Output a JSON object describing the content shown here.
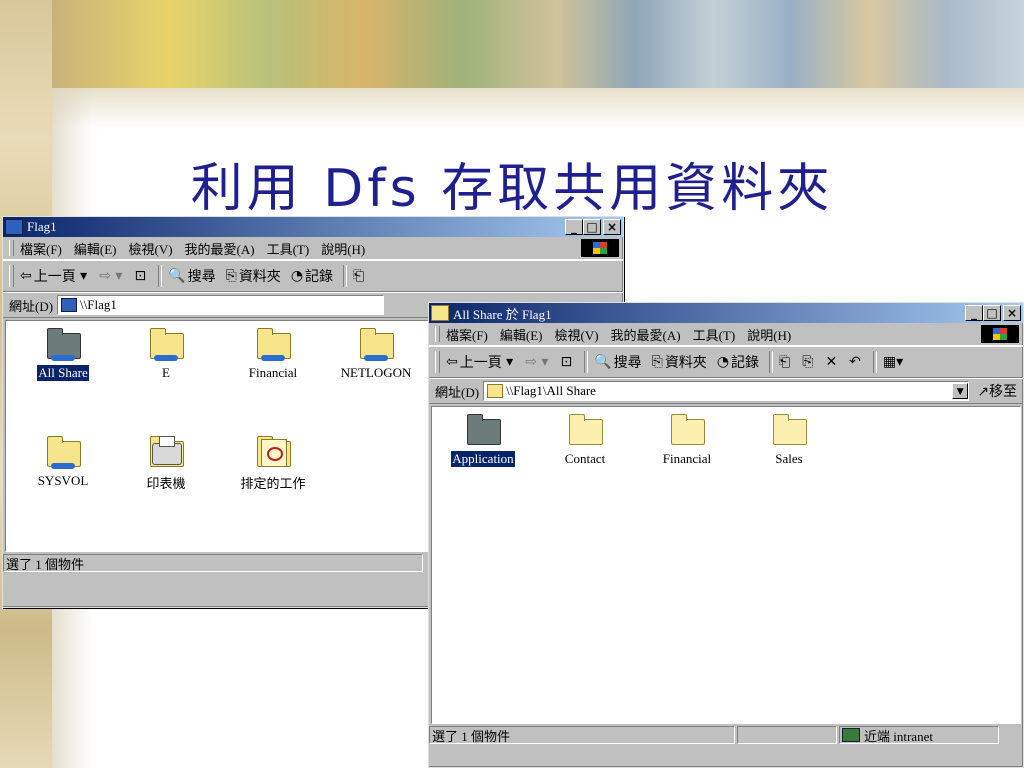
{
  "slide": {
    "title_prefix": "利用 ",
    "title_latin": "Dfs",
    "title_suffix": " 存取共用資料夾"
  },
  "window1": {
    "title": "Flag1",
    "menu": [
      "檔案(F)",
      "編輯(E)",
      "檢視(V)",
      "我的最愛(A)",
      "工具(T)",
      "說明(H)"
    ],
    "toolbar": {
      "back": "上一頁",
      "search": "搜尋",
      "folders": "資料夾",
      "history": "記錄"
    },
    "address_label": "網址(D)",
    "address_value": "\\\\Flag1",
    "items": [
      {
        "label": "All Share",
        "icon": "shared-folder-gray-icon",
        "selected": true
      },
      {
        "label": "E",
        "icon": "shared-folder-icon",
        "selected": false
      },
      {
        "label": "Financial",
        "icon": "shared-folder-icon",
        "selected": false
      },
      {
        "label": "NETLOGON",
        "icon": "shared-folder-icon",
        "selected": false
      },
      {
        "label": "SYSVOL",
        "icon": "shared-folder-icon",
        "selected": false
      },
      {
        "label": "印表機",
        "icon": "printers-folder-icon",
        "selected": false
      },
      {
        "label": "排定的工作",
        "icon": "scheduled-tasks-icon",
        "selected": false
      }
    ],
    "status": "選了 1 個物件"
  },
  "window2": {
    "title": "All Share 於 Flag1",
    "menu": [
      "檔案(F)",
      "編輯(E)",
      "檢視(V)",
      "我的最愛(A)",
      "工具(T)",
      "說明(H)"
    ],
    "toolbar": {
      "back": "上一頁",
      "search": "搜尋",
      "folders": "資料夾",
      "history": "記錄"
    },
    "address_label": "網址(D)",
    "address_value": "\\\\Flag1\\All Share",
    "go_label": "移至",
    "items": [
      {
        "label": "Application",
        "icon": "folder-gray-icon",
        "selected": true
      },
      {
        "label": "Contact",
        "icon": "folder-icon",
        "selected": false
      },
      {
        "label": "Financial",
        "icon": "folder-icon",
        "selected": false
      },
      {
        "label": "Sales",
        "icon": "folder-icon",
        "selected": false
      }
    ],
    "status": "選了 1 個物件",
    "zone": "近端 intranet"
  },
  "colors": {
    "title_text": "#1f1f8f",
    "titlebar_start": "#0a246a",
    "titlebar_end": "#a6caf0",
    "selection": "#0a246a"
  }
}
